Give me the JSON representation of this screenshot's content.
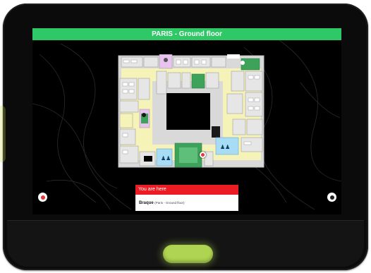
{
  "screen": {
    "title": "PARIS - Ground floor"
  },
  "info_panel": {
    "header": "You are here",
    "room_name": "Braque",
    "room_location": "(Paris - Ground floor)"
  },
  "colors": {
    "title_bar": "#2ec866",
    "panel_header": "#ec1c24",
    "home_button": "#aed451",
    "corridor": "#f6f3b8",
    "meeting_room": "#3da35a",
    "restroom": "#a8dcf5",
    "special_room": "#e8c3f0"
  },
  "icons": {
    "zoom_left": "location-target-icon",
    "zoom_right": "compass-icon",
    "restroom_left": "restroom-icon",
    "restroom_right": "restroom-icon"
  }
}
